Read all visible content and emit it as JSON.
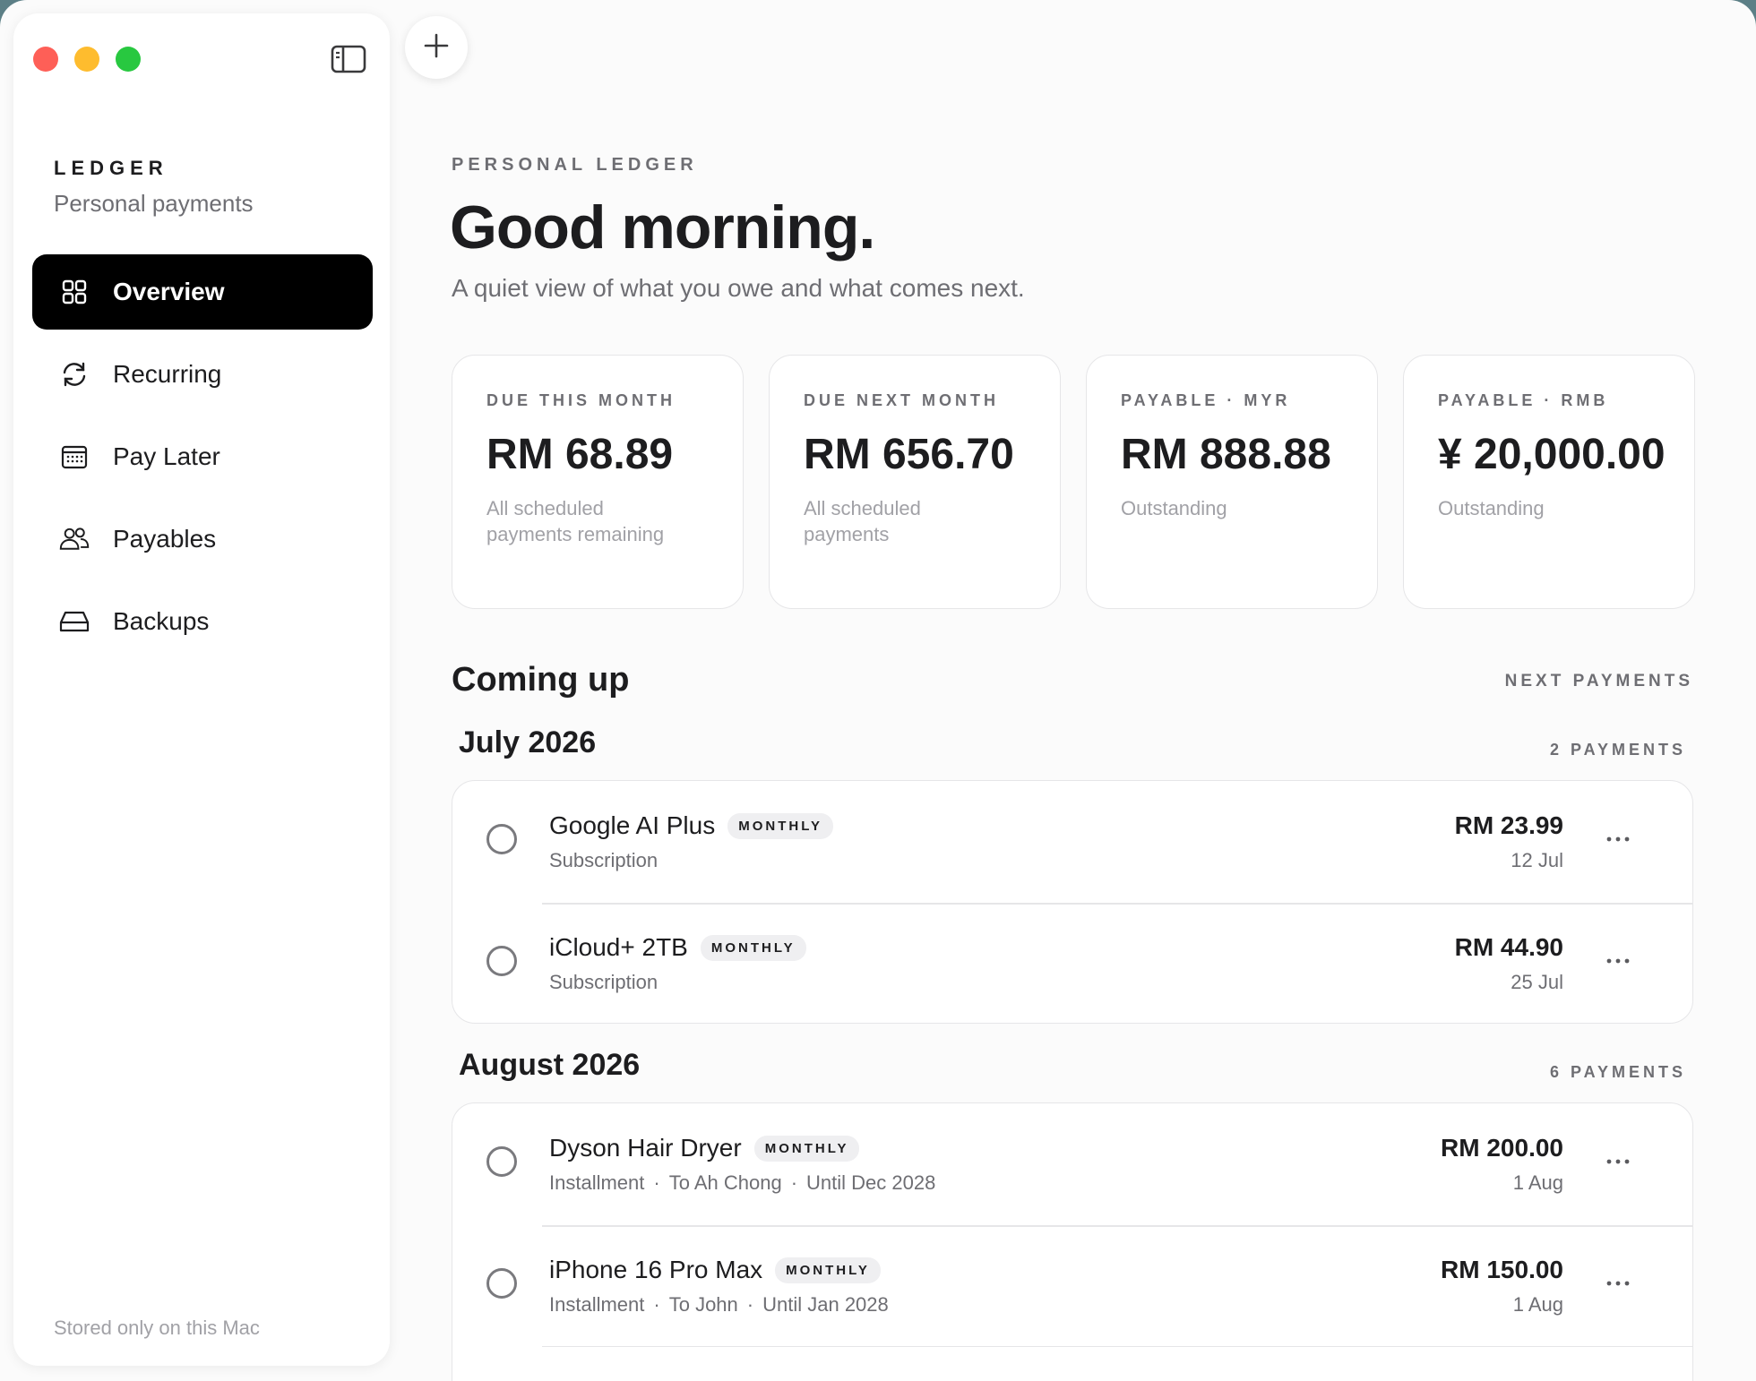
{
  "sidebar": {
    "brand_title": "LEDGER",
    "brand_subtitle": "Personal payments",
    "items": [
      {
        "label": "Overview",
        "icon": "grid-icon",
        "active": true
      },
      {
        "label": "Recurring",
        "icon": "refresh-icon"
      },
      {
        "label": "Pay Later",
        "icon": "calendar-icon"
      },
      {
        "label": "Payables",
        "icon": "people-icon"
      },
      {
        "label": "Backups",
        "icon": "drive-icon"
      }
    ],
    "footer": "Stored only on this Mac"
  },
  "header": {
    "eyebrow": "PERSONAL LEDGER",
    "greeting": "Good morning.",
    "lede": "A quiet view of what you owe and what comes next."
  },
  "stats": [
    {
      "label": "DUE THIS MONTH",
      "value": "RM 68.89",
      "note": "All scheduled payments remaining"
    },
    {
      "label": "DUE NEXT MONTH",
      "value": "RM 656.70",
      "note": "All scheduled payments"
    },
    {
      "label": "PAYABLE · MYR",
      "value": "RM 888.88",
      "note": "Outstanding"
    },
    {
      "label": "PAYABLE · RMB",
      "value": "¥ 20,000.00",
      "note": "Outstanding"
    }
  ],
  "coming_up": {
    "title": "Coming up",
    "tag": "NEXT PAYMENTS",
    "months": [
      {
        "title": "July 2026",
        "count": "2 PAYMENTS",
        "rows": [
          {
            "name": "Google AI Plus",
            "badge": "MONTHLY",
            "sub": [
              "Subscription"
            ],
            "amount": "RM 23.99",
            "date": "12 Jul"
          },
          {
            "name": "iCloud+ 2TB",
            "badge": "MONTHLY",
            "sub": [
              "Subscription"
            ],
            "amount": "RM 44.90",
            "date": "25 Jul"
          }
        ]
      },
      {
        "title": "August 2026",
        "count": "6 PAYMENTS",
        "rows": [
          {
            "name": "Dyson Hair Dryer",
            "badge": "MONTHLY",
            "sub": [
              "Installment",
              "To Ah Chong",
              "Until Dec 2028"
            ],
            "amount": "RM 200.00",
            "date": "1 Aug"
          },
          {
            "name": "iPhone 16 Pro Max",
            "badge": "MONTHLY",
            "sub": [
              "Installment",
              "To John",
              "Until Jan 2028"
            ],
            "amount": "RM 150.00",
            "date": "1 Aug"
          }
        ]
      }
    ]
  },
  "colors": {
    "accent": "#000000",
    "traffic_red": "#fe5f57",
    "traffic_yellow": "#febc2e",
    "traffic_green": "#28c840"
  }
}
